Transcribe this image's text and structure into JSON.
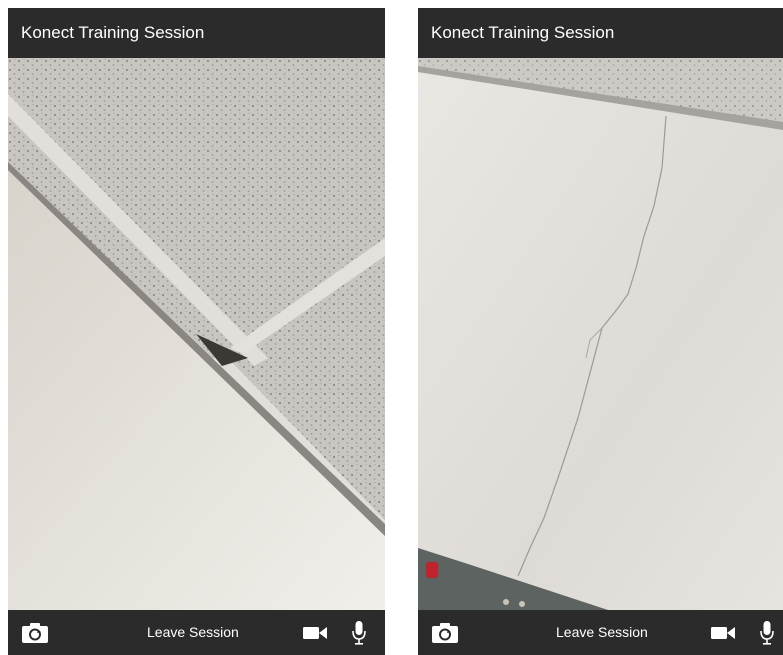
{
  "left_phone": {
    "title": "Konect Training Session",
    "leave_label": "Leave Session",
    "icons": [
      "camera-flip-icon",
      "video-camera-icon",
      "microphone-icon"
    ]
  },
  "right_phone": {
    "title": "Konect Training Session",
    "leave_label": "Leave Session",
    "icons": [
      "camera-flip-icon",
      "video-camera-icon",
      "microphone-icon"
    ]
  },
  "colors": {
    "bar_background": "#2b2b2b",
    "bar_text": "#ffffff"
  }
}
